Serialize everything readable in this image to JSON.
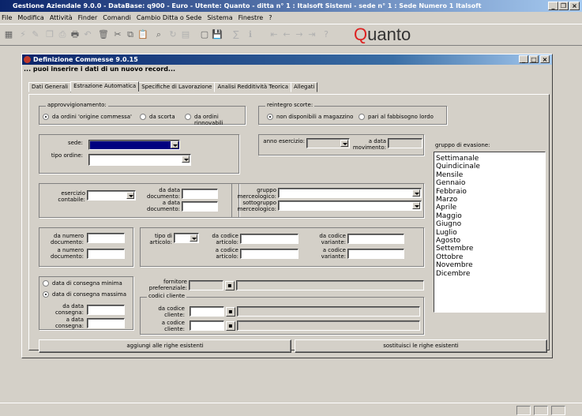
{
  "app": {
    "title": "Gestione Aziendale 9.0.0 - DataBase: q900 - Euro - Utente: Quanto - ditta n° 1 : Italsoft Sistemi - sede n° 1 : Sede Numero 1 Italsoft"
  },
  "menu": [
    "File",
    "Modifica",
    "Attività",
    "Finder",
    "Comandi",
    "Cambio Ditta o Sede",
    "Sistema",
    "Finestre",
    "?"
  ],
  "logo": {
    "text": "uanto",
    "letter": "Q"
  },
  "window": {
    "title": "Definizione Commesse 9.0.15",
    "subtitle": "... puoi inserire i dati di un nuovo record..."
  },
  "tabs": [
    "Dati Generali",
    "Estrazione Automatica",
    "Specifiche di Lavorazione",
    "Analisi Redditività Teorica",
    "Allegati"
  ],
  "form": {
    "approvv_label": "approvvigionamento:",
    "approvv_options": [
      "da ordini 'origine commessa'",
      "da scorta",
      "da ordini rinnovabili"
    ],
    "reintegro_label": "reintegro scorte:",
    "reintegro_options": [
      "non disponibili a magazzino",
      "pari al fabbisogno lordo"
    ],
    "sede": "sede:",
    "tipo_ordine": "tipo ordine:",
    "anno_esercizio": "anno esercizio:",
    "a_data_movimento": "a data movimento:",
    "esercizio_contabile": "esercizio contabile:",
    "da_data_documento": "da data documento:",
    "a_data_documento": "a data documento:",
    "gruppo_merceologico": "gruppo merceologico:",
    "sottogruppo_merceologico": "sottogruppo merceologico:",
    "da_numero_documento": "da numero documento:",
    "a_numero_documento": "a numero documento:",
    "tipo_articolo": "tipo di articolo:",
    "da_codice_articolo": "da codice articolo:",
    "a_codice_articolo": "a codice articolo:",
    "da_codice_variante": "da codice variante:",
    "a_codice_variante": "a codice variante:",
    "consegna_options": [
      "data di consegna minima",
      "data di consegna massima"
    ],
    "da_data_consegna": "da data consegna:",
    "a_data_consegna": "a data consegna:",
    "fornitore_preferenziale": "fornitore preferenziale:",
    "codici_cliente": "codici cliente",
    "da_codice_cliente": "da codice cliente:",
    "a_codice_cliente": "a codice cliente:",
    "gruppo_evasione_label": "gruppo di evasione:",
    "gruppo_evasione": [
      "Settimanale",
      "Quindicinale",
      "Mensile",
      "Gennaio",
      "Febbraio",
      "Marzo",
      "Aprile",
      "Maggio",
      "Giugno",
      "Luglio",
      "Agosto",
      "Settembre",
      "Ottobre",
      "Novembre",
      "Dicembre"
    ]
  },
  "buttons": {
    "aggiungi": "aggiungi alle righe esistenti",
    "sostituisci": "sostituisci le righe esistenti"
  }
}
